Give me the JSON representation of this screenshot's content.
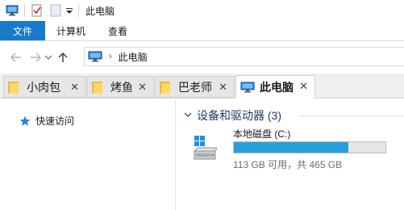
{
  "window": {
    "title": "此电脑"
  },
  "ribbon": {
    "tabs": [
      "文件",
      "计算机",
      "查看"
    ]
  },
  "address": {
    "location": "此电脑"
  },
  "tabs": [
    {
      "label": "小肉包",
      "active": false
    },
    {
      "label": "烤鱼",
      "active": false
    },
    {
      "label": "巴老师",
      "active": false
    },
    {
      "label": "此电脑",
      "active": true
    }
  ],
  "sidebar": {
    "items": [
      {
        "label": "快速访问"
      }
    ]
  },
  "main": {
    "group_title": "设备和驱动器 (3)",
    "drive": {
      "name": "本地磁盘 (C:)",
      "free_text": "113 GB 可用，共 465 GB",
      "used_fraction": 0.757,
      "bar_color": "#26a0da"
    }
  },
  "colors": {
    "accent": "#1979ca"
  }
}
